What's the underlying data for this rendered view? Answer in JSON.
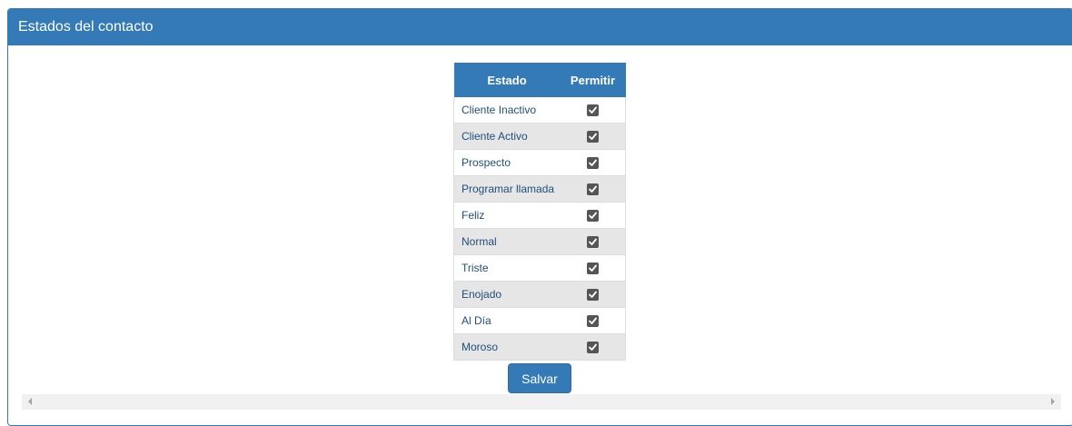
{
  "panel": {
    "title": "Estados del contacto"
  },
  "table": {
    "headers": {
      "estado": "Estado",
      "permitir": "Permitir"
    },
    "rows": [
      {
        "label": "Cliente Inactivo",
        "checked": true
      },
      {
        "label": "Cliente Activo",
        "checked": true
      },
      {
        "label": "Prospecto",
        "checked": true
      },
      {
        "label": "Programar llamada",
        "checked": true
      },
      {
        "label": "Feliz",
        "checked": true
      },
      {
        "label": "Normal",
        "checked": true
      },
      {
        "label": "Triste",
        "checked": true
      },
      {
        "label": "Enojado",
        "checked": true
      },
      {
        "label": "Al Día",
        "checked": true
      },
      {
        "label": "Moroso",
        "checked": true
      }
    ]
  },
  "actions": {
    "save_label": "Salvar"
  },
  "colors": {
    "primary": "#337ab7",
    "row_alt": "#e6e6e6",
    "checkbox": "#555555"
  },
  "icons": {
    "checkbox": "checkmark-icon",
    "scroll_left": "scroll-left-arrow-icon",
    "scroll_right": "scroll-right-arrow-icon"
  }
}
